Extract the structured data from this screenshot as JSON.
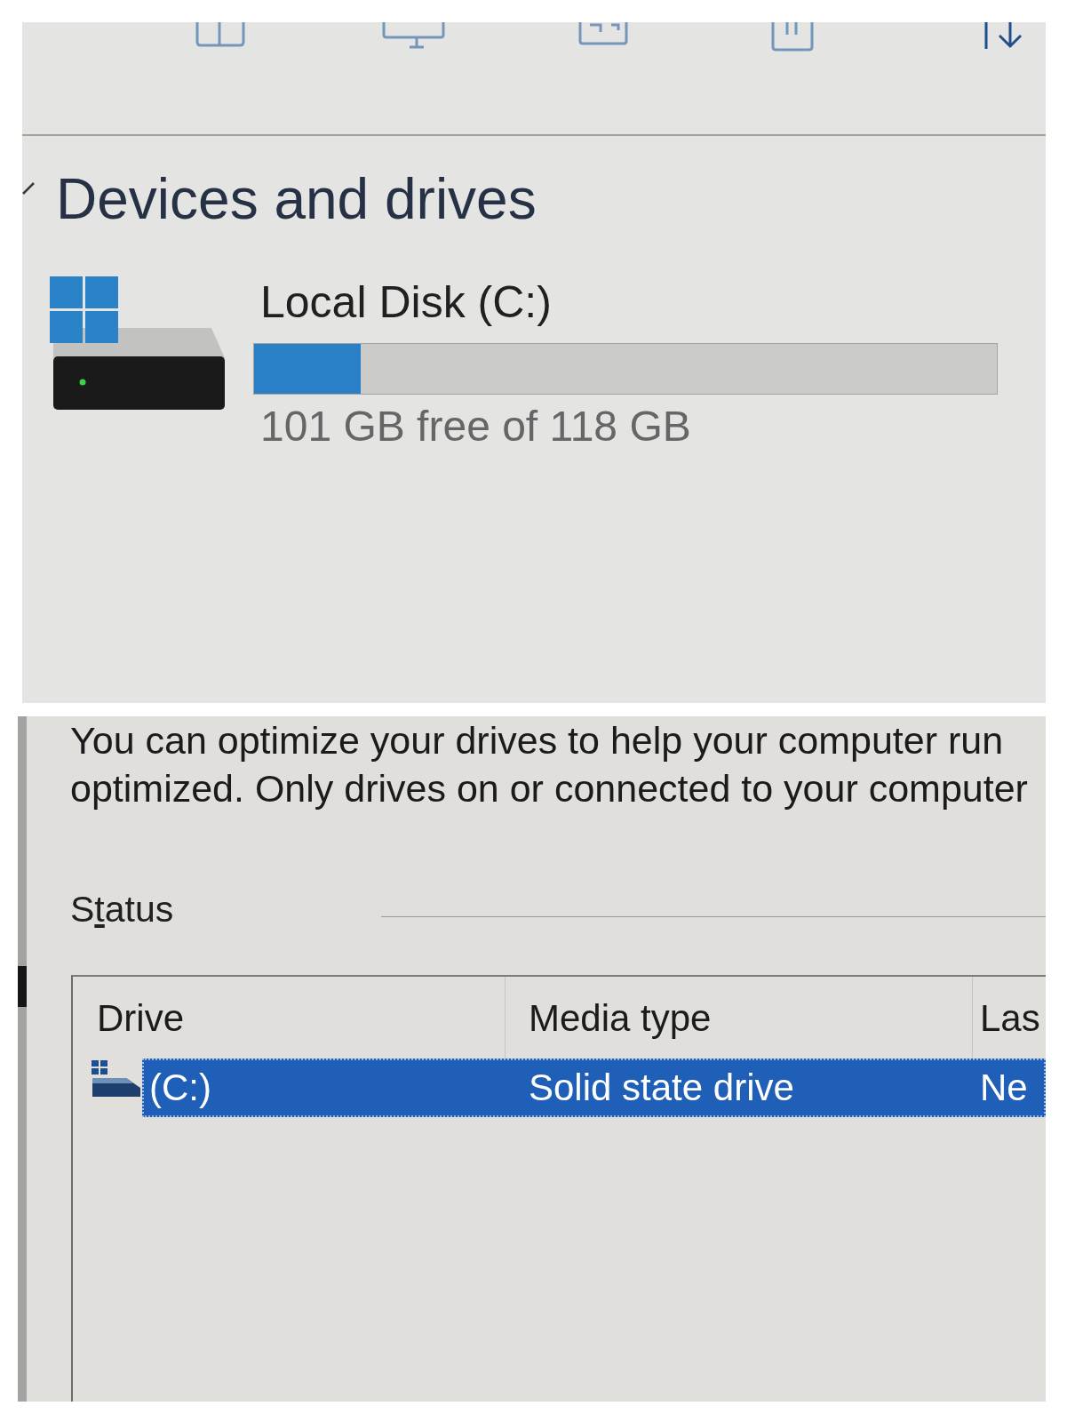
{
  "section": {
    "title": "Devices and drives",
    "expanded": true
  },
  "drives": [
    {
      "name": "Local Disk (C:)",
      "level": 0.144,
      "space": "101 GB free of 118 GB"
    }
  ],
  "optimize": {
    "description": [
      "You can optimize your drives to help your computer run",
      "optimized. Only drives on or connected to your computer"
    ],
    "status": {
      "label_parts": [
        {
          "text": "S",
          "underlined": false
        },
        {
          "text": "t",
          "underlined": true
        },
        {
          "text": "atus",
          "underlined": false
        }
      ]
    },
    "table": {
      "columns": [
        "Drive",
        "Media type",
        "Las"
      ],
      "rows": [
        {
          "selected": true,
          "cells": [
            "(C:)",
            "Solid state drive",
            "Ne"
          ]
        }
      ]
    }
  }
}
